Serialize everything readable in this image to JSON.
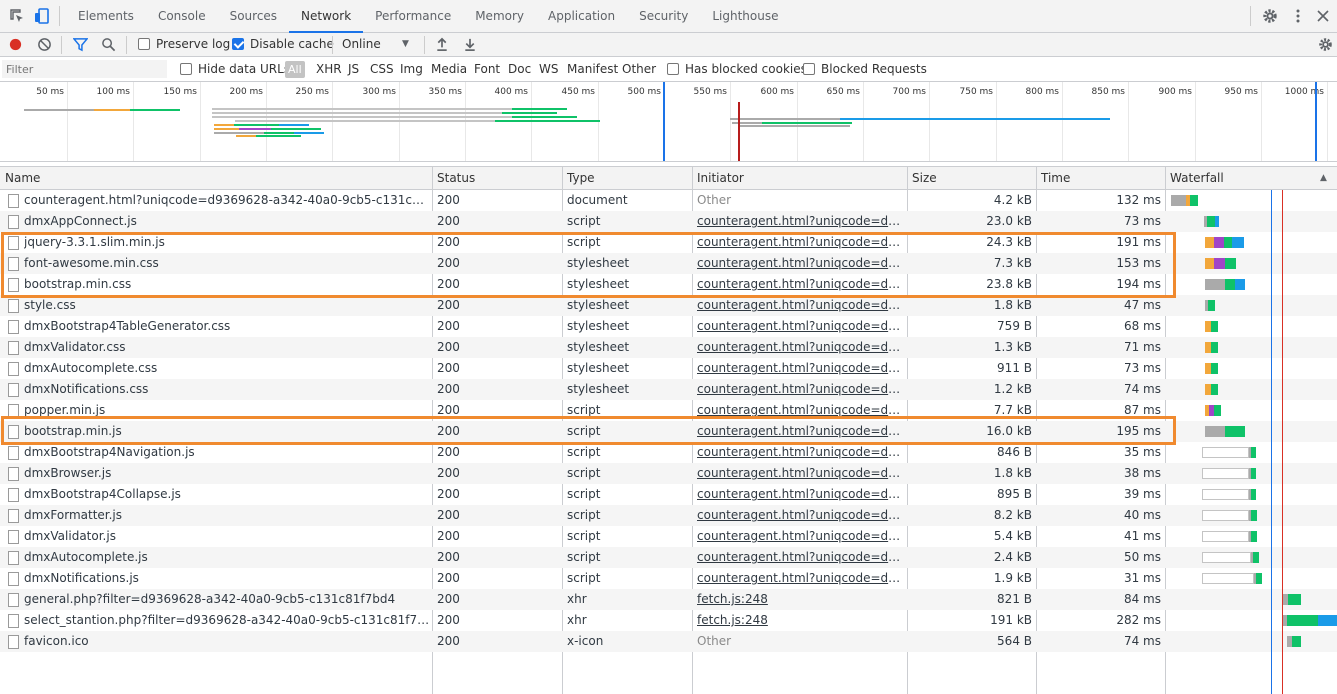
{
  "tabs": [
    {
      "label": "Elements"
    },
    {
      "label": "Console"
    },
    {
      "label": "Sources"
    },
    {
      "label": "Network",
      "active": true
    },
    {
      "label": "Performance"
    },
    {
      "label": "Memory"
    },
    {
      "label": "Application"
    },
    {
      "label": "Security"
    },
    {
      "label": "Lighthouse"
    }
  ],
  "toolbar": {
    "preserve_log": "Preserve log",
    "preserve_log_checked": false,
    "disable_cache": "Disable cache",
    "disable_cache_checked": true,
    "throttling": "Online",
    "record_color": "#d93025"
  },
  "filter": {
    "placeholder": "Filter",
    "hide_data_urls": "Hide data URLs",
    "types": [
      "All",
      "XHR",
      "JS",
      "CSS",
      "Img",
      "Media",
      "Font",
      "Doc",
      "WS",
      "Manifest",
      "Other"
    ],
    "has_blocked_cookies": "Has blocked cookies",
    "blocked_requests": "Blocked Requests"
  },
  "overview": {
    "ticks": [
      "50 ms",
      "100 ms",
      "150 ms",
      "200 ms",
      "250 ms",
      "300 ms",
      "350 ms",
      "400 ms",
      "450 ms",
      "500 ms",
      "550 ms",
      "600 ms",
      "650 ms",
      "700 ms",
      "750 ms",
      "800 ms",
      "850 ms",
      "900 ms",
      "950 ms",
      "1000 ms"
    ]
  },
  "columns": {
    "name": "Name",
    "status": "Status",
    "type": "Type",
    "initiator": "Initiator",
    "size": "Size",
    "time": "Time",
    "waterfall": "Waterfall"
  },
  "rows": [
    {
      "name": "counteragent.html?uniqcode=d9369628-a342-40a0-9cb5-c131c81f7bd4",
      "status": "200",
      "type": "document",
      "initiator": "Other",
      "initiator_link": false,
      "size": "4.2 kB",
      "time": "132 ms"
    },
    {
      "name": "dmxAppConnect.js",
      "status": "200",
      "type": "script",
      "initiator": "counteragent.html?uniqcode=d9369...",
      "initiator_link": true,
      "size": "23.0 kB",
      "time": "73 ms"
    },
    {
      "name": "jquery-3.3.1.slim.min.js",
      "status": "200",
      "type": "script",
      "initiator": "counteragent.html?uniqcode=d9369...",
      "initiator_link": true,
      "size": "24.3 kB",
      "time": "191 ms"
    },
    {
      "name": "font-awesome.min.css",
      "status": "200",
      "type": "stylesheet",
      "initiator": "counteragent.html?uniqcode=d9369...",
      "initiator_link": true,
      "size": "7.3 kB",
      "time": "153 ms"
    },
    {
      "name": "bootstrap.min.css",
      "status": "200",
      "type": "stylesheet",
      "initiator": "counteragent.html?uniqcode=d9369...",
      "initiator_link": true,
      "size": "23.8 kB",
      "time": "194 ms"
    },
    {
      "name": "style.css",
      "status": "200",
      "type": "stylesheet",
      "initiator": "counteragent.html?uniqcode=d9369...",
      "initiator_link": true,
      "size": "1.8 kB",
      "time": "47 ms"
    },
    {
      "name": "dmxBootstrap4TableGenerator.css",
      "status": "200",
      "type": "stylesheet",
      "initiator": "counteragent.html?uniqcode=d9369...",
      "initiator_link": true,
      "size": "759 B",
      "time": "68 ms"
    },
    {
      "name": "dmxValidator.css",
      "status": "200",
      "type": "stylesheet",
      "initiator": "counteragent.html?uniqcode=d9369...",
      "initiator_link": true,
      "size": "1.3 kB",
      "time": "71 ms"
    },
    {
      "name": "dmxAutocomplete.css",
      "status": "200",
      "type": "stylesheet",
      "initiator": "counteragent.html?uniqcode=d9369...",
      "initiator_link": true,
      "size": "911 B",
      "time": "73 ms"
    },
    {
      "name": "dmxNotifications.css",
      "status": "200",
      "type": "stylesheet",
      "initiator": "counteragent.html?uniqcode=d9369...",
      "initiator_link": true,
      "size": "1.2 kB",
      "time": "74 ms"
    },
    {
      "name": "popper.min.js",
      "status": "200",
      "type": "script",
      "initiator": "counteragent.html?uniqcode=d9369...",
      "initiator_link": true,
      "size": "7.7 kB",
      "time": "87 ms"
    },
    {
      "name": "bootstrap.min.js",
      "status": "200",
      "type": "script",
      "initiator": "counteragent.html?uniqcode=d9369...",
      "initiator_link": true,
      "size": "16.0 kB",
      "time": "195 ms"
    },
    {
      "name": "dmxBootstrap4Navigation.js",
      "status": "200",
      "type": "script",
      "initiator": "counteragent.html?uniqcode=d9369...",
      "initiator_link": true,
      "size": "846 B",
      "time": "35 ms"
    },
    {
      "name": "dmxBrowser.js",
      "status": "200",
      "type": "script",
      "initiator": "counteragent.html?uniqcode=d9369...",
      "initiator_link": true,
      "size": "1.8 kB",
      "time": "38 ms"
    },
    {
      "name": "dmxBootstrap4Collapse.js",
      "status": "200",
      "type": "script",
      "initiator": "counteragent.html?uniqcode=d9369...",
      "initiator_link": true,
      "size": "895 B",
      "time": "39 ms"
    },
    {
      "name": "dmxFormatter.js",
      "status": "200",
      "type": "script",
      "initiator": "counteragent.html?uniqcode=d9369...",
      "initiator_link": true,
      "size": "8.2 kB",
      "time": "40 ms"
    },
    {
      "name": "dmxValidator.js",
      "status": "200",
      "type": "script",
      "initiator": "counteragent.html?uniqcode=d9369...",
      "initiator_link": true,
      "size": "5.4 kB",
      "time": "41 ms"
    },
    {
      "name": "dmxAutocomplete.js",
      "status": "200",
      "type": "script",
      "initiator": "counteragent.html?uniqcode=d9369...",
      "initiator_link": true,
      "size": "2.4 kB",
      "time": "50 ms"
    },
    {
      "name": "dmxNotifications.js",
      "status": "200",
      "type": "script",
      "initiator": "counteragent.html?uniqcode=d9369...",
      "initiator_link": true,
      "size": "1.9 kB",
      "time": "31 ms"
    },
    {
      "name": "general.php?filter=d9369628-a342-40a0-9cb5-c131c81f7bd4",
      "status": "200",
      "type": "xhr",
      "initiator": "fetch.js:248",
      "initiator_link": true,
      "size": "821 B",
      "time": "84 ms"
    },
    {
      "name": "select_stantion.php?filter=d9369628-a342-40a0-9cb5-c131c81f7bd4",
      "status": "200",
      "type": "xhr",
      "initiator": "fetch.js:248",
      "initiator_link": true,
      "size": "191 kB",
      "time": "282 ms"
    },
    {
      "name": "favicon.ico",
      "status": "200",
      "type": "x-icon",
      "initiator": "Other",
      "initiator_link": false,
      "size": "564 B",
      "time": "74 ms"
    }
  ],
  "colors": {
    "accent": "#1a73e8",
    "highlight": "#f08a2f",
    "waiting": "#aaaaaa",
    "ssl": "#f2a73b",
    "connect": "#a045c7",
    "ttfb": "#0fc268",
    "download": "#1a9be8"
  }
}
